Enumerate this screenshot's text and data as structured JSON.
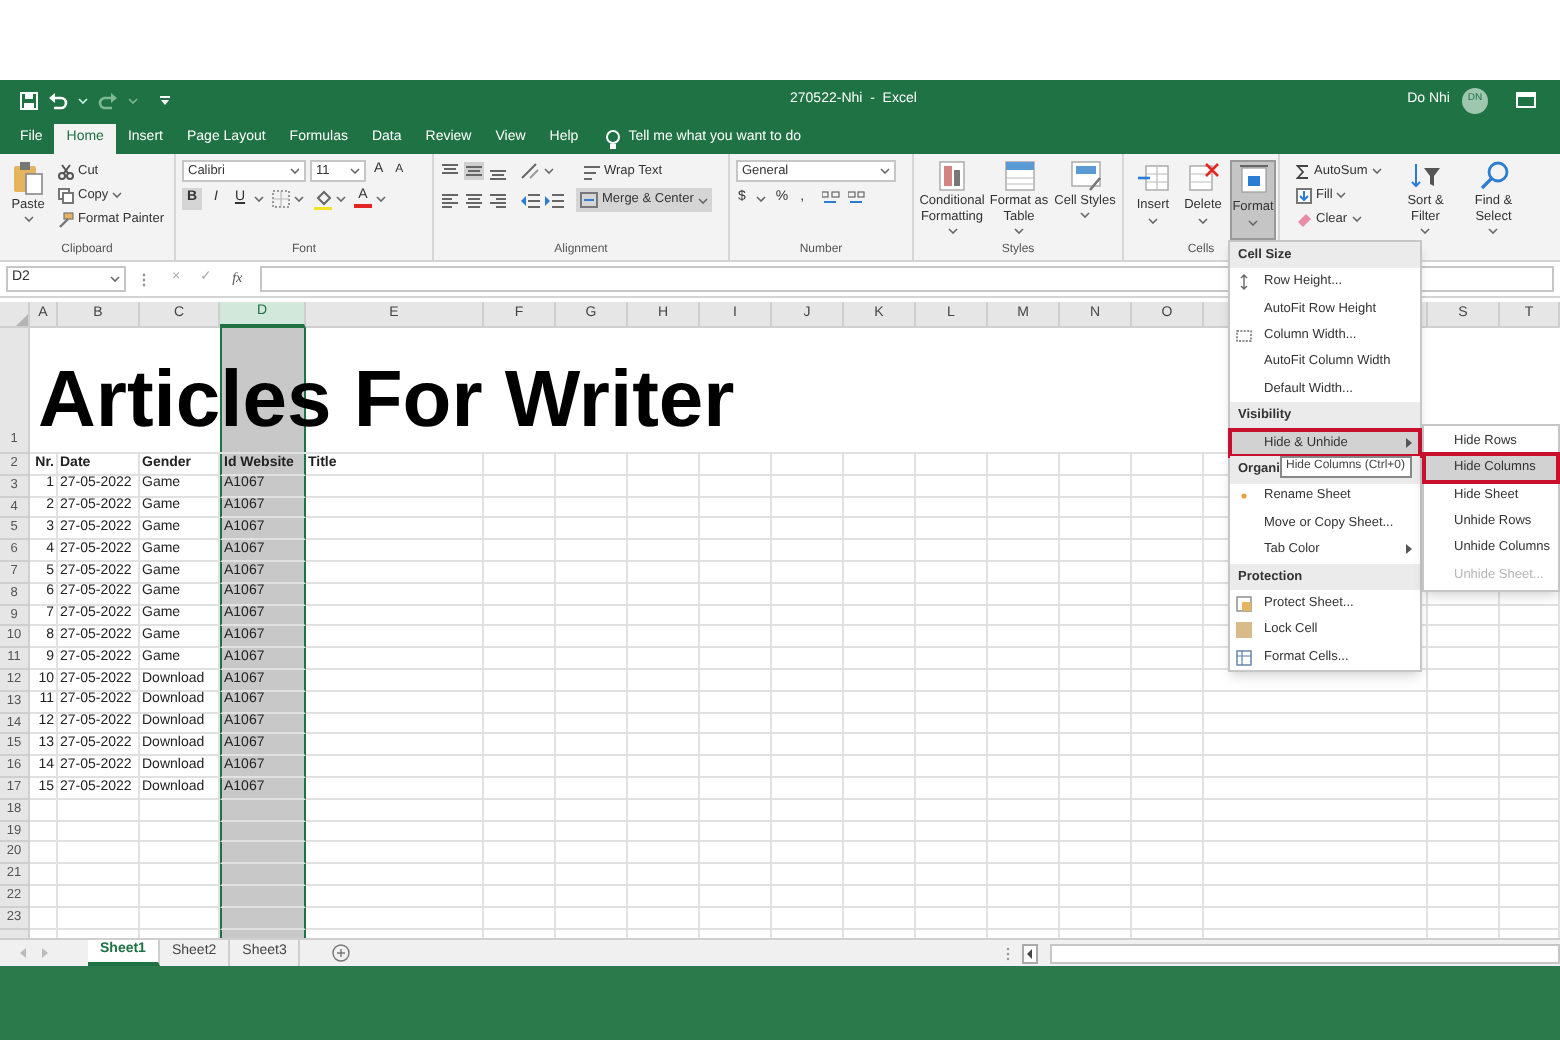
{
  "title_bar": {
    "document_title": "270522-Nhi  -  Excel",
    "user_name": "Do Nhi",
    "user_initials": "DN"
  },
  "ribbon_tabs": [
    {
      "label": "File",
      "selected": false
    },
    {
      "label": "Home",
      "selected": true
    },
    {
      "label": "Insert",
      "selected": false
    },
    {
      "label": "Page Layout",
      "selected": false
    },
    {
      "label": "Formulas",
      "selected": false
    },
    {
      "label": "Data",
      "selected": false
    },
    {
      "label": "Review",
      "selected": false
    },
    {
      "label": "View",
      "selected": false
    },
    {
      "label": "Help",
      "selected": false
    }
  ],
  "tell_me": "Tell me what you want to do",
  "ribbon": {
    "clipboard": {
      "label": "Clipboard",
      "paste": "Paste",
      "cut": "Cut",
      "copy": "Copy",
      "format_painter": "Format Painter"
    },
    "font": {
      "label": "Font",
      "font_name": "Calibri",
      "font_size": "11",
      "grow_font": "A",
      "shrink_font": "A",
      "bold": "B",
      "italic": "I",
      "underline": "U",
      "font_color": "A"
    },
    "alignment": {
      "label": "Alignment",
      "wrap_text": "Wrap Text",
      "merge_center": "Merge & Center"
    },
    "number": {
      "label": "Number",
      "format": "General",
      "currency": "$",
      "percent": "%",
      "comma": ","
    },
    "styles": {
      "label": "Styles",
      "buttons": [
        "Conditional Formatting",
        "Format as Table",
        "Cell Styles"
      ]
    },
    "cells": {
      "label": "Cells",
      "buttons": [
        {
          "label": "Insert",
          "selected": false
        },
        {
          "label": "Delete",
          "selected": false
        },
        {
          "label": "Format",
          "selected": true
        }
      ]
    },
    "editing": {
      "autosum": "AutoSum",
      "fill": "Fill",
      "clear": "Clear",
      "sort_filter": "Sort & Filter",
      "find_select": "Find & Select"
    }
  },
  "formula_bar": {
    "name_box": "D2",
    "cancel": "×",
    "enter": "✓",
    "function": "fx"
  },
  "columns": [
    {
      "label": "A",
      "selected": false
    },
    {
      "label": "B",
      "selected": false
    },
    {
      "label": "C",
      "selected": false
    },
    {
      "label": "D",
      "selected": true
    },
    {
      "label": "E",
      "selected": false
    },
    {
      "label": "F",
      "selected": false
    },
    {
      "label": "G",
      "selected": false
    },
    {
      "label": "H",
      "selected": false
    },
    {
      "label": "I",
      "selected": false
    },
    {
      "label": "J",
      "selected": false
    },
    {
      "label": "K",
      "selected": false
    },
    {
      "label": "L",
      "selected": false
    },
    {
      "label": "M",
      "selected": false
    },
    {
      "label": "N",
      "selected": false
    },
    {
      "label": "O",
      "selected": false
    },
    {
      "label": "S",
      "selected": false
    },
    {
      "label": "T",
      "selected": false
    }
  ],
  "rows": [
    {
      "number": "1",
      "kind": "title",
      "cells": [
        "Articles For Writer"
      ]
    },
    {
      "number": "2",
      "kind": "header",
      "cells": [
        "Nr.",
        "Date",
        "Gender",
        "Id Website",
        "Title"
      ]
    },
    {
      "number": "3",
      "kind": "data",
      "cells": [
        "1",
        "27-05-2022",
        "Game",
        "A1067"
      ]
    },
    {
      "number": "4",
      "kind": "data",
      "cells": [
        "2",
        "27-05-2022",
        "Game",
        "A1067"
      ]
    },
    {
      "number": "5",
      "kind": "data",
      "cells": [
        "3",
        "27-05-2022",
        "Game",
        "A1067"
      ]
    },
    {
      "number": "6",
      "kind": "data",
      "cells": [
        "4",
        "27-05-2022",
        "Game",
        "A1067"
      ]
    },
    {
      "number": "7",
      "kind": "data",
      "cells": [
        "5",
        "27-05-2022",
        "Game",
        "A1067"
      ]
    },
    {
      "number": "8",
      "kind": "data",
      "cells": [
        "6",
        "27-05-2022",
        "Game",
        "A1067"
      ]
    },
    {
      "number": "9",
      "kind": "data",
      "cells": [
        "7",
        "27-05-2022",
        "Game",
        "A1067"
      ]
    },
    {
      "number": "10",
      "kind": "data",
      "cells": [
        "8",
        "27-05-2022",
        "Game",
        "A1067"
      ]
    },
    {
      "number": "11",
      "kind": "data",
      "cells": [
        "9",
        "27-05-2022",
        "Game",
        "A1067"
      ]
    },
    {
      "number": "12",
      "kind": "data",
      "cells": [
        "10",
        "27-05-2022",
        "Download",
        "A1067"
      ]
    },
    {
      "number": "13",
      "kind": "data",
      "cells": [
        "11",
        "27-05-2022",
        "Download",
        "A1067"
      ]
    },
    {
      "number": "14",
      "kind": "data",
      "cells": [
        "12",
        "27-05-2022",
        "Download",
        "A1067"
      ]
    },
    {
      "number": "15",
      "kind": "data",
      "cells": [
        "13",
        "27-05-2022",
        "Download",
        "A1067"
      ]
    },
    {
      "number": "16",
      "kind": "data",
      "cells": [
        "14",
        "27-05-2022",
        "Download",
        "A1067"
      ]
    },
    {
      "number": "17",
      "kind": "data",
      "cells": [
        "15",
        "27-05-2022",
        "Download",
        "A1067"
      ]
    },
    {
      "number": "18",
      "kind": "data"
    },
    {
      "number": "19",
      "kind": "data"
    },
    {
      "number": "20",
      "kind": "data"
    },
    {
      "number": "21",
      "kind": "data"
    },
    {
      "number": "22",
      "kind": "data"
    },
    {
      "number": "23",
      "kind": "data"
    }
  ],
  "format_menu": {
    "items": [
      {
        "kind": "header",
        "label": "Cell Size"
      },
      {
        "kind": "item",
        "label": "Row Height...",
        "selected": false
      },
      {
        "kind": "item",
        "label": "AutoFit Row Height",
        "selected": false
      },
      {
        "kind": "item",
        "label": "Column Width...",
        "selected": false
      },
      {
        "kind": "item",
        "label": "AutoFit Column Width",
        "selected": false
      },
      {
        "kind": "item",
        "label": "Default Width...",
        "selected": false
      },
      {
        "kind": "header",
        "label": "Visibility"
      },
      {
        "kind": "submenu",
        "label": "Hide & Unhide",
        "selected": true
      },
      {
        "kind": "header",
        "label": "Organi"
      },
      {
        "kind": "item",
        "label": "Rename Sheet",
        "selected": false
      },
      {
        "kind": "item",
        "label": "Move or Copy Sheet...",
        "selected": false
      },
      {
        "kind": "submenu",
        "label": "Tab Color",
        "selected": false
      },
      {
        "kind": "header",
        "label": "Protection"
      },
      {
        "kind": "item",
        "label": "Protect Sheet...",
        "selected": false
      },
      {
        "kind": "item",
        "label": "Lock Cell",
        "selected": false
      },
      {
        "kind": "item",
        "label": "Format Cells...",
        "selected": false
      }
    ],
    "submenu": [
      {
        "label": "Hide Rows",
        "selected": false,
        "disabled": false
      },
      {
        "label": "Hide Columns",
        "selected": true,
        "disabled": false
      },
      {
        "label": "Hide Sheet",
        "selected": false,
        "disabled": false
      },
      {
        "label": "Unhide Rows",
        "selected": false,
        "disabled": false
      },
      {
        "label": "Unhide Columns",
        "selected": false,
        "disabled": false
      },
      {
        "label": "Unhide Sheet...",
        "selected": false,
        "disabled": true
      }
    ],
    "tooltip": "Hide Columns (Ctrl+0)"
  },
  "sheet_tabs": [
    {
      "label": "Sheet1",
      "selected": true
    },
    {
      "label": "Sheet2",
      "selected": false
    },
    {
      "label": "Sheet3",
      "selected": false
    }
  ]
}
